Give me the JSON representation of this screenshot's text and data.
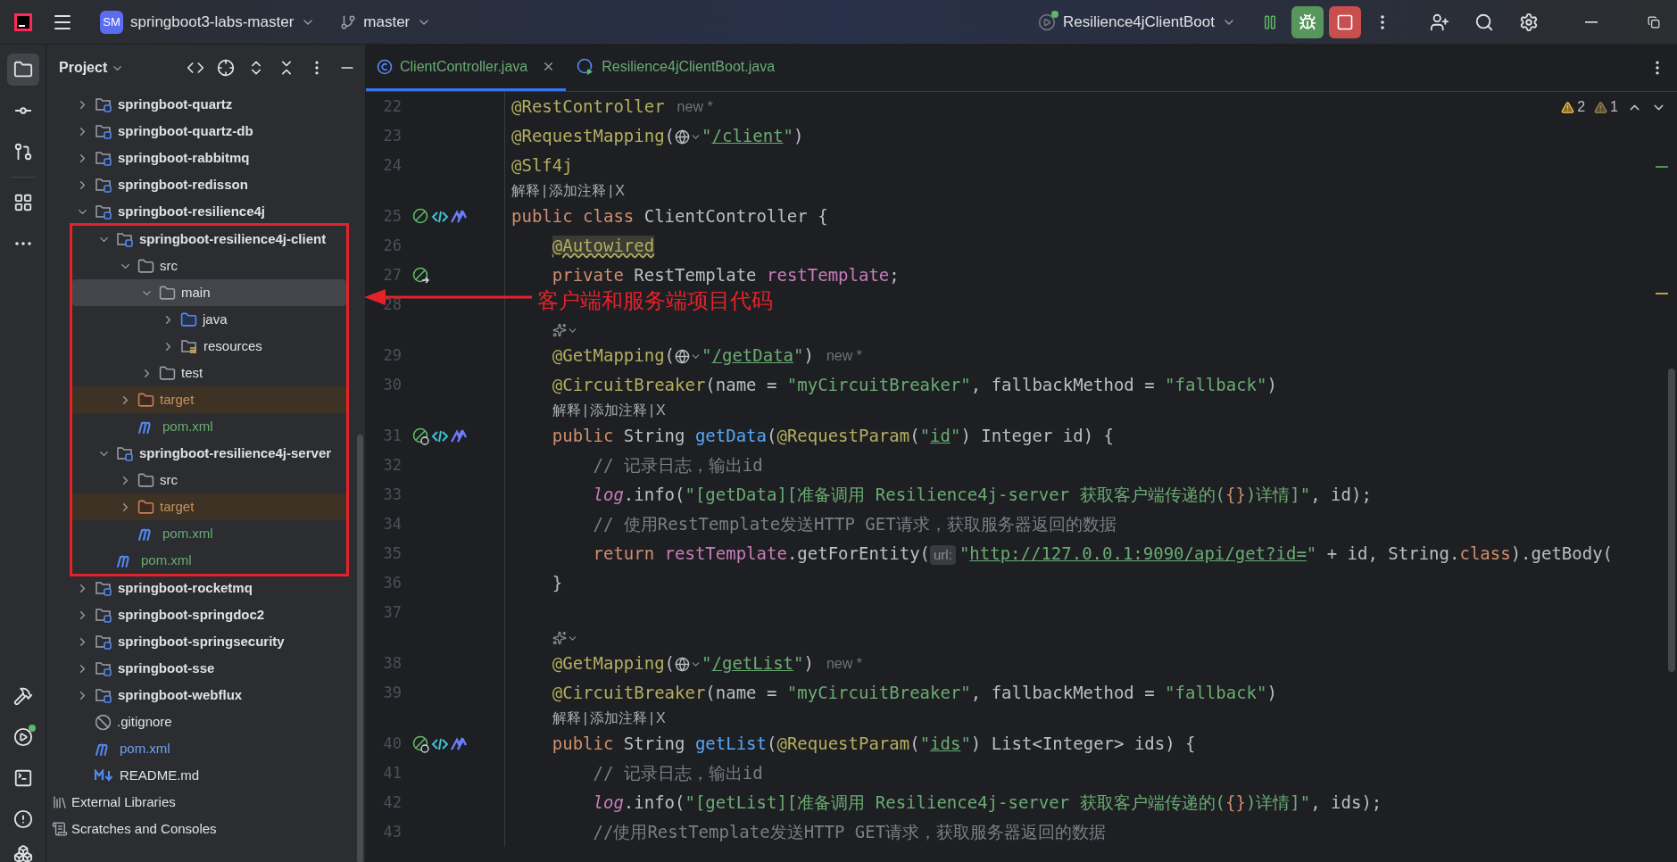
{
  "title_bar": {
    "project_badge": "SM",
    "project": "springboot3-labs-master",
    "branch": "master",
    "run_config": "Resilience4jClientBoot"
  },
  "project_panel": {
    "title": "Project",
    "tree": [
      {
        "name": "springboot-quartz",
        "kind": "module",
        "expanded": false,
        "selected": false
      },
      {
        "name": "springboot-quartz-db",
        "kind": "module",
        "expanded": false,
        "selected": false
      },
      {
        "name": "springboot-rabbitmq",
        "kind": "module",
        "expanded": false,
        "selected": false
      },
      {
        "name": "springboot-redisson",
        "kind": "module",
        "expanded": false,
        "selected": false
      },
      {
        "name": "springboot-resilience4j",
        "kind": "module",
        "expanded": true,
        "selected": false,
        "boxed": true,
        "children": [
          {
            "name": "springboot-resilience4j-client",
            "kind": "module",
            "expanded": true,
            "selected": false,
            "children": [
              {
                "name": "src",
                "kind": "folder",
                "expanded": true,
                "selected": false,
                "children": [
                  {
                    "name": "main",
                    "kind": "folder",
                    "expanded": true,
                    "selected": true,
                    "children": [
                      {
                        "name": "java",
                        "kind": "source_folder",
                        "expanded": false,
                        "selected": false
                      },
                      {
                        "name": "resources",
                        "kind": "resources_folder",
                        "expanded": false,
                        "selected": false
                      }
                    ]
                  },
                  {
                    "name": "test",
                    "kind": "folder",
                    "expanded": false,
                    "selected": false
                  }
                ]
              },
              {
                "name": "target",
                "kind": "excluded_folder",
                "expanded": false,
                "selected": false,
                "color": "#c7915e"
              },
              {
                "name": "pom.xml",
                "kind": "maven",
                "selected": false,
                "color": "#6aab73"
              }
            ]
          },
          {
            "name": "springboot-resilience4j-server",
            "kind": "module",
            "expanded": true,
            "selected": false,
            "children": [
              {
                "name": "src",
                "kind": "folder",
                "expanded": false,
                "selected": false
              },
              {
                "name": "target",
                "kind": "excluded_folder",
                "expanded": false,
                "selected": false,
                "color": "#c7915e"
              },
              {
                "name": "pom.xml",
                "kind": "maven",
                "selected": false,
                "color": "#6aab73"
              }
            ]
          },
          {
            "name": "pom.xml",
            "kind": "maven",
            "selected": false,
            "color": "#6aab73"
          }
        ]
      },
      {
        "name": "springboot-rocketmq",
        "kind": "module",
        "expanded": false,
        "selected": false
      },
      {
        "name": "springboot-springdoc2",
        "kind": "module",
        "expanded": false,
        "selected": false
      },
      {
        "name": "springboot-springsecurity",
        "kind": "module",
        "expanded": false,
        "selected": false
      },
      {
        "name": "springboot-sse",
        "kind": "module",
        "expanded": false,
        "selected": false
      },
      {
        "name": "springboot-webflux",
        "kind": "module",
        "expanded": false,
        "selected": false
      },
      {
        "name": ".gitignore",
        "kind": "gitignore",
        "selected": false
      },
      {
        "name": "pom.xml",
        "kind": "maven",
        "selected": false,
        "color": "#6f9ff5"
      },
      {
        "name": "README.md",
        "kind": "markdown",
        "selected": false
      }
    ],
    "bottom_nodes": [
      {
        "name": "External Libraries",
        "kind": "libraries",
        "selected": false
      },
      {
        "name": "Scratches and Consoles",
        "kind": "scratches",
        "selected": false
      }
    ]
  },
  "editor": {
    "tabs": [
      {
        "label": "ClientController.java",
        "kind": "class",
        "selected": true,
        "color": "#6aab73"
      },
      {
        "label": "Resilience4jClientBoot.java",
        "kind": "run_class",
        "selected": false,
        "color": "#6aab73"
      }
    ],
    "inspections": [
      {
        "kind": "warning",
        "count": "2"
      },
      {
        "kind": "weak_warning",
        "count": "1"
      }
    ],
    "lines": [
      {
        "kind": "code",
        "number": "22",
        "tokens": [
          {
            "kind": "annotation",
            "text": "@RestController"
          }
        ],
        "hint": "new *"
      },
      {
        "kind": "code",
        "number": "23",
        "tokens": [
          {
            "kind": "annotation",
            "text": "@RequestMapping"
          },
          {
            "kind": "plain",
            "text": "("
          },
          {
            "kind": "globe"
          },
          {
            "kind": "string",
            "text": "\""
          },
          {
            "kind": "url",
            "text": "/client"
          },
          {
            "kind": "string",
            "text": "\""
          },
          {
            "kind": "plain",
            "text": ")"
          }
        ]
      },
      {
        "kind": "code",
        "number": "24",
        "tokens": [
          {
            "kind": "annotation",
            "text": "@Slf4j"
          }
        ]
      },
      {
        "kind": "actions",
        "items": [
          "解释",
          "添加注释",
          "X"
        ],
        "separator": "|"
      },
      {
        "kind": "code",
        "number": "25",
        "gutter": [
          {
            "kind": "bean"
          },
          {
            "kind": "link"
          },
          {
            "kind": "ai"
          }
        ],
        "tokens": [
          {
            "kind": "keyword",
            "text": "public class "
          },
          {
            "kind": "plain",
            "text": "ClientController {"
          }
        ]
      },
      {
        "kind": "code",
        "number": "26",
        "tokens": [
          {
            "kind": "annotation_warn",
            "text": "    @Autowired"
          }
        ]
      },
      {
        "kind": "code",
        "number": "27",
        "gutter": [
          {
            "kind": "bean_nav"
          }
        ],
        "tokens": [
          {
            "kind": "keyword",
            "text": "    private "
          },
          {
            "kind": "plain",
            "text": "RestTemplate "
          },
          {
            "kind": "field",
            "text": "restTemplate"
          },
          {
            "kind": "plain",
            "text": ";"
          }
        ]
      },
      {
        "kind": "code",
        "number": "28"
      },
      {
        "kind": "ai_row"
      },
      {
        "kind": "code",
        "number": "29",
        "tokens": [
          {
            "kind": "annotation",
            "text": "    @GetMapping"
          },
          {
            "kind": "plain",
            "text": "("
          },
          {
            "kind": "globe"
          },
          {
            "kind": "string",
            "text": "\""
          },
          {
            "kind": "url",
            "text": "/getData"
          },
          {
            "kind": "string",
            "text": "\""
          },
          {
            "kind": "plain",
            "text": ")"
          }
        ],
        "hint": "new *"
      },
      {
        "kind": "code",
        "number": "30",
        "tokens": [
          {
            "kind": "annotation",
            "text": "    @CircuitBreaker"
          },
          {
            "kind": "plain",
            "text": "(name = "
          },
          {
            "kind": "string",
            "text": "\"myCircuitBreaker\""
          },
          {
            "kind": "plain",
            "text": ", fallbackMethod = "
          },
          {
            "kind": "string",
            "text": "\"fallback\""
          },
          {
            "kind": "plain",
            "text": ")"
          }
        ]
      },
      {
        "kind": "actions",
        "items": [
          "解释",
          "添加注释",
          "X"
        ],
        "separator": "|"
      },
      {
        "kind": "code",
        "number": "31",
        "gutter": [
          {
            "kind": "bean_web"
          },
          {
            "kind": "link"
          },
          {
            "kind": "ai"
          }
        ],
        "tokens": [
          {
            "kind": "keyword",
            "text": "    public "
          },
          {
            "kind": "plain",
            "text": "String "
          },
          {
            "kind": "method",
            "text": "getData"
          },
          {
            "kind": "plain",
            "text": "("
          },
          {
            "kind": "annotation",
            "text": "@RequestParam"
          },
          {
            "kind": "plain",
            "text": "("
          },
          {
            "kind": "string",
            "text": "\""
          },
          {
            "kind": "url",
            "text": "id"
          },
          {
            "kind": "string",
            "text": "\""
          },
          {
            "kind": "plain",
            "text": ") Integer id) {"
          }
        ]
      },
      {
        "kind": "code",
        "number": "32",
        "tokens": [
          {
            "kind": "comment",
            "text": "        // 记录日志，输出id"
          }
        ]
      },
      {
        "kind": "code",
        "number": "33",
        "tokens": [
          {
            "kind": "static_field",
            "text": "        log"
          },
          {
            "kind": "plain",
            "text": ".info("
          },
          {
            "kind": "string",
            "text": "\"[getData][准备调用 Resilience4j-server 获取客户端传递的("
          },
          {
            "kind": "placeholder",
            "text": "{}"
          },
          {
            "kind": "string",
            "text": ")详情]\""
          },
          {
            "kind": "plain",
            "text": ", id);"
          }
        ]
      },
      {
        "kind": "code",
        "number": "34",
        "tokens": [
          {
            "kind": "comment",
            "text": "        // 使用RestTemplate发送HTTP GET请求，获取服务器返回的数据"
          }
        ]
      },
      {
        "kind": "code",
        "number": "35",
        "tokens": [
          {
            "kind": "keyword",
            "text": "        return "
          },
          {
            "kind": "field",
            "text": "restTemplate"
          },
          {
            "kind": "plain",
            "text": ".getForEntity("
          },
          {
            "kind": "param_hint",
            "text": "url:"
          },
          {
            "kind": "string",
            "text": "\""
          },
          {
            "kind": "url",
            "text": "http://127.0.0.1:9090/api/get?id="
          },
          {
            "kind": "string",
            "text": "\""
          },
          {
            "kind": "plain",
            "text": " + id, String."
          },
          {
            "kind": "keyword",
            "text": "class"
          },
          {
            "kind": "plain",
            "text": ").getBody("
          }
        ]
      },
      {
        "kind": "code",
        "number": "36",
        "tokens": [
          {
            "kind": "plain",
            "text": "    }"
          }
        ]
      },
      {
        "kind": "code",
        "number": "37"
      },
      {
        "kind": "ai_row"
      },
      {
        "kind": "code",
        "number": "38",
        "tokens": [
          {
            "kind": "annotation",
            "text": "    @GetMapping"
          },
          {
            "kind": "plain",
            "text": "("
          },
          {
            "kind": "globe"
          },
          {
            "kind": "string",
            "text": "\""
          },
          {
            "kind": "url",
            "text": "/getList"
          },
          {
            "kind": "string",
            "text": "\""
          },
          {
            "kind": "plain",
            "text": ")"
          }
        ],
        "hint": "new *"
      },
      {
        "kind": "code",
        "number": "39",
        "tokens": [
          {
            "kind": "annotation",
            "text": "    @CircuitBreaker"
          },
          {
            "kind": "plain",
            "text": "(name = "
          },
          {
            "kind": "string",
            "text": "\"myCircuitBreaker\""
          },
          {
            "kind": "plain",
            "text": ", fallbackMethod = "
          },
          {
            "kind": "string",
            "text": "\"fallback\""
          },
          {
            "kind": "plain",
            "text": ")"
          }
        ]
      },
      {
        "kind": "actions",
        "items": [
          "解释",
          "添加注释",
          "X"
        ],
        "separator": "|"
      },
      {
        "kind": "code",
        "number": "40",
        "gutter": [
          {
            "kind": "bean_web"
          },
          {
            "kind": "link"
          },
          {
            "kind": "ai"
          }
        ],
        "tokens": [
          {
            "kind": "keyword",
            "text": "    public "
          },
          {
            "kind": "plain",
            "text": "String "
          },
          {
            "kind": "method",
            "text": "getList"
          },
          {
            "kind": "plain",
            "text": "("
          },
          {
            "kind": "annotation",
            "text": "@RequestParam"
          },
          {
            "kind": "plain",
            "text": "("
          },
          {
            "kind": "string",
            "text": "\""
          },
          {
            "kind": "url",
            "text": "ids"
          },
          {
            "kind": "string",
            "text": "\""
          },
          {
            "kind": "plain",
            "text": ") List<Integer> ids) {"
          }
        ]
      },
      {
        "kind": "code",
        "number": "41",
        "tokens": [
          {
            "kind": "comment",
            "text": "        // 记录日志，输出id"
          }
        ]
      },
      {
        "kind": "code",
        "number": "42",
        "tokens": [
          {
            "kind": "static_field",
            "text": "        log"
          },
          {
            "kind": "plain",
            "text": ".info("
          },
          {
            "kind": "string",
            "text": "\"[getList][准备调用 Resilience4j-server 获取客户端传递的("
          },
          {
            "kind": "placeholder",
            "text": "{}"
          },
          {
            "kind": "string",
            "text": ")详情]\""
          },
          {
            "kind": "plain",
            "text": ", ids);"
          }
        ]
      },
      {
        "kind": "code",
        "number": "43",
        "tokens": [
          {
            "kind": "comment",
            "text": "        //使用RestTemplate发送HTTP GET请求，获取服务器返回的数据"
          }
        ]
      }
    ]
  },
  "annotation": {
    "text": "客户端和服务端项目代码"
  }
}
